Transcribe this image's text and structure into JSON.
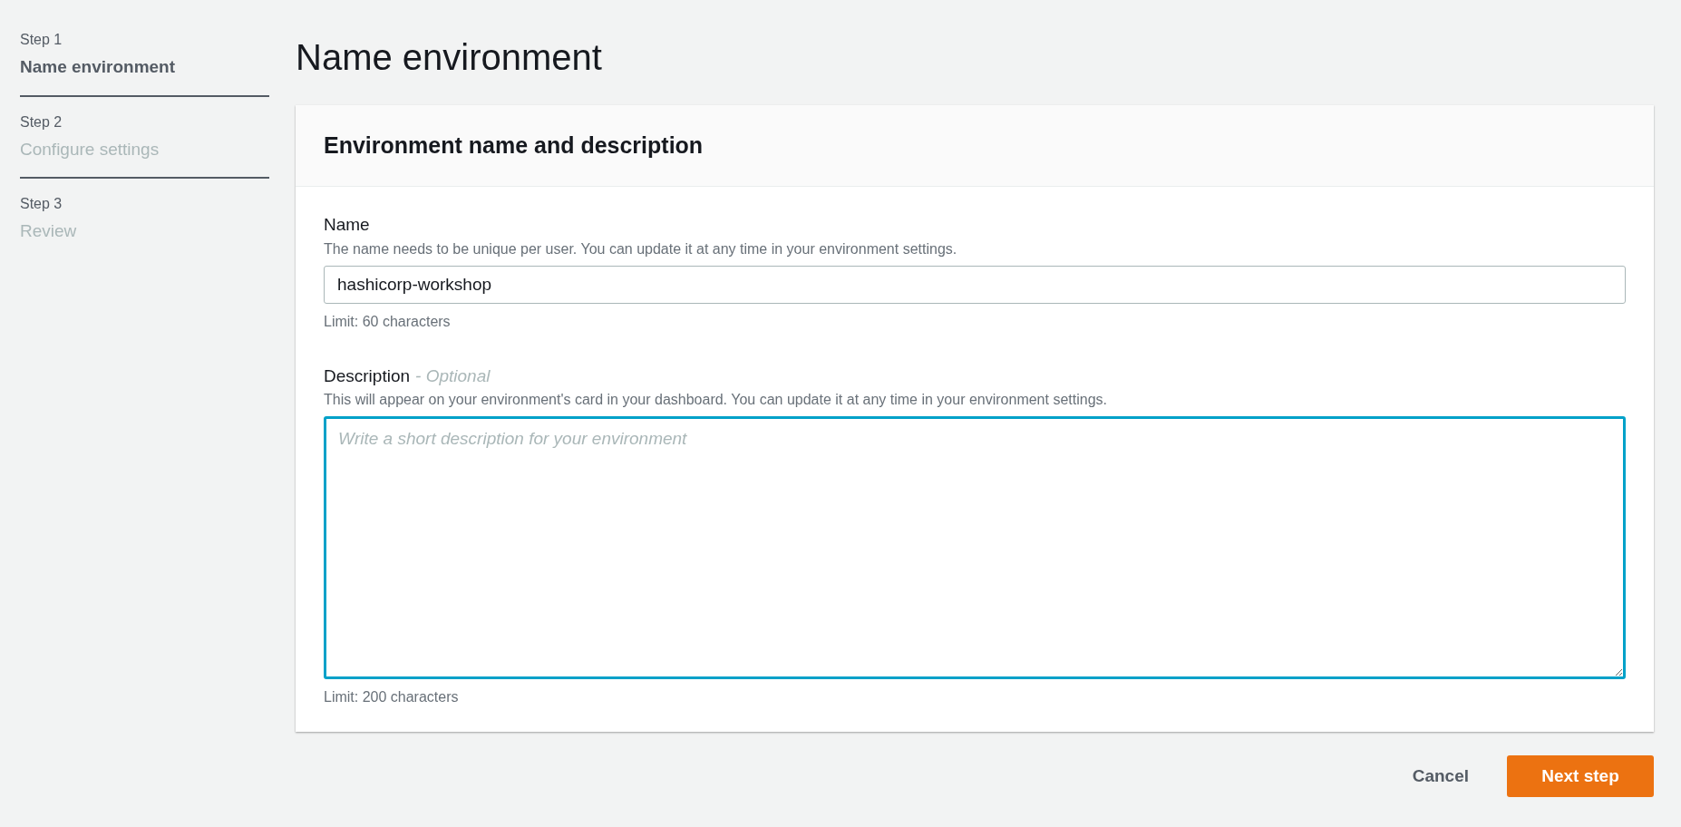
{
  "steps": [
    {
      "step": "Step 1",
      "label": "Name environment",
      "selected": true
    },
    {
      "step": "Step 2",
      "label": "Configure settings",
      "selected": false
    },
    {
      "step": "Step 3",
      "label": "Review",
      "selected": false
    }
  ],
  "page_title": "Name environment",
  "card": {
    "title": "Environment name and description",
    "fields": [
      {
        "kind": "input",
        "label": "Name",
        "description": "The name needs to be unique per user. You can update it at any time in your environment settings.",
        "value": "hashicorp-workshop",
        "constraint": "Limit: 60 characters",
        "focused": false
      },
      {
        "kind": "textarea",
        "label": "Description",
        "optional": "- Optional",
        "description": "This will appear on your environment's card in your dashboard. You can update it at any time in your environment settings.",
        "placeholder": "Write a short description for your environment",
        "constraint": "Limit: 200 characters",
        "focused": true
      }
    ]
  },
  "buttons": {
    "cancel": "Cancel",
    "next": "Next step"
  }
}
